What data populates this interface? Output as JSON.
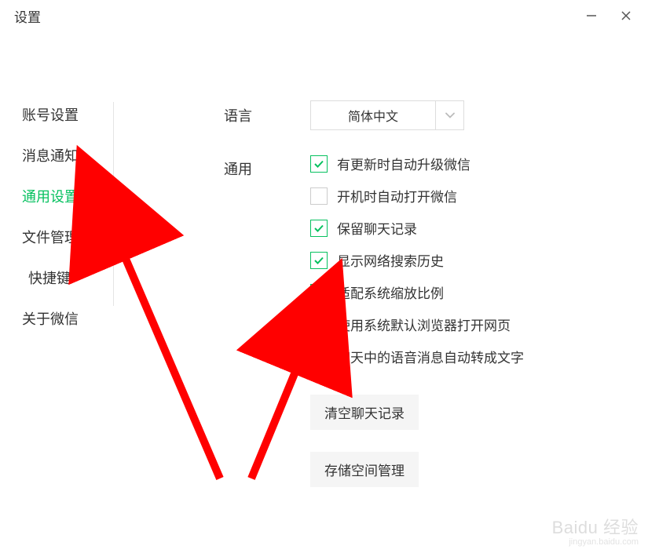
{
  "window": {
    "title": "设置"
  },
  "sidebar": {
    "items": [
      {
        "label": "账号设置",
        "active": false
      },
      {
        "label": "消息通知",
        "active": false
      },
      {
        "label": "通用设置",
        "active": true
      },
      {
        "label": "文件管理",
        "active": false
      },
      {
        "label": "快捷键",
        "active": false
      },
      {
        "label": "关于微信",
        "active": false
      }
    ]
  },
  "settings": {
    "language": {
      "label": "语言",
      "value": "简体中文"
    },
    "general": {
      "label": "通用",
      "checkboxes": [
        {
          "label": "有更新时自动升级微信",
          "checked": true
        },
        {
          "label": "开机时自动打开微信",
          "checked": false
        },
        {
          "label": "保留聊天记录",
          "checked": true
        },
        {
          "label": "显示网络搜索历史",
          "checked": true
        },
        {
          "label": "适配系统缩放比例",
          "checked": true
        },
        {
          "label": "使用系统默认浏览器打开网页",
          "checked": false
        },
        {
          "label": "聊天中的语音消息自动转成文字",
          "checked": false
        }
      ],
      "buttons": [
        {
          "label": "清空聊天记录"
        },
        {
          "label": "存储空间管理"
        }
      ]
    }
  },
  "watermark": {
    "main": "Baidu 经验",
    "sub": "jingyan.baidu.com"
  },
  "colors": {
    "accent": "#07c160",
    "annotation": "#ff0000"
  }
}
